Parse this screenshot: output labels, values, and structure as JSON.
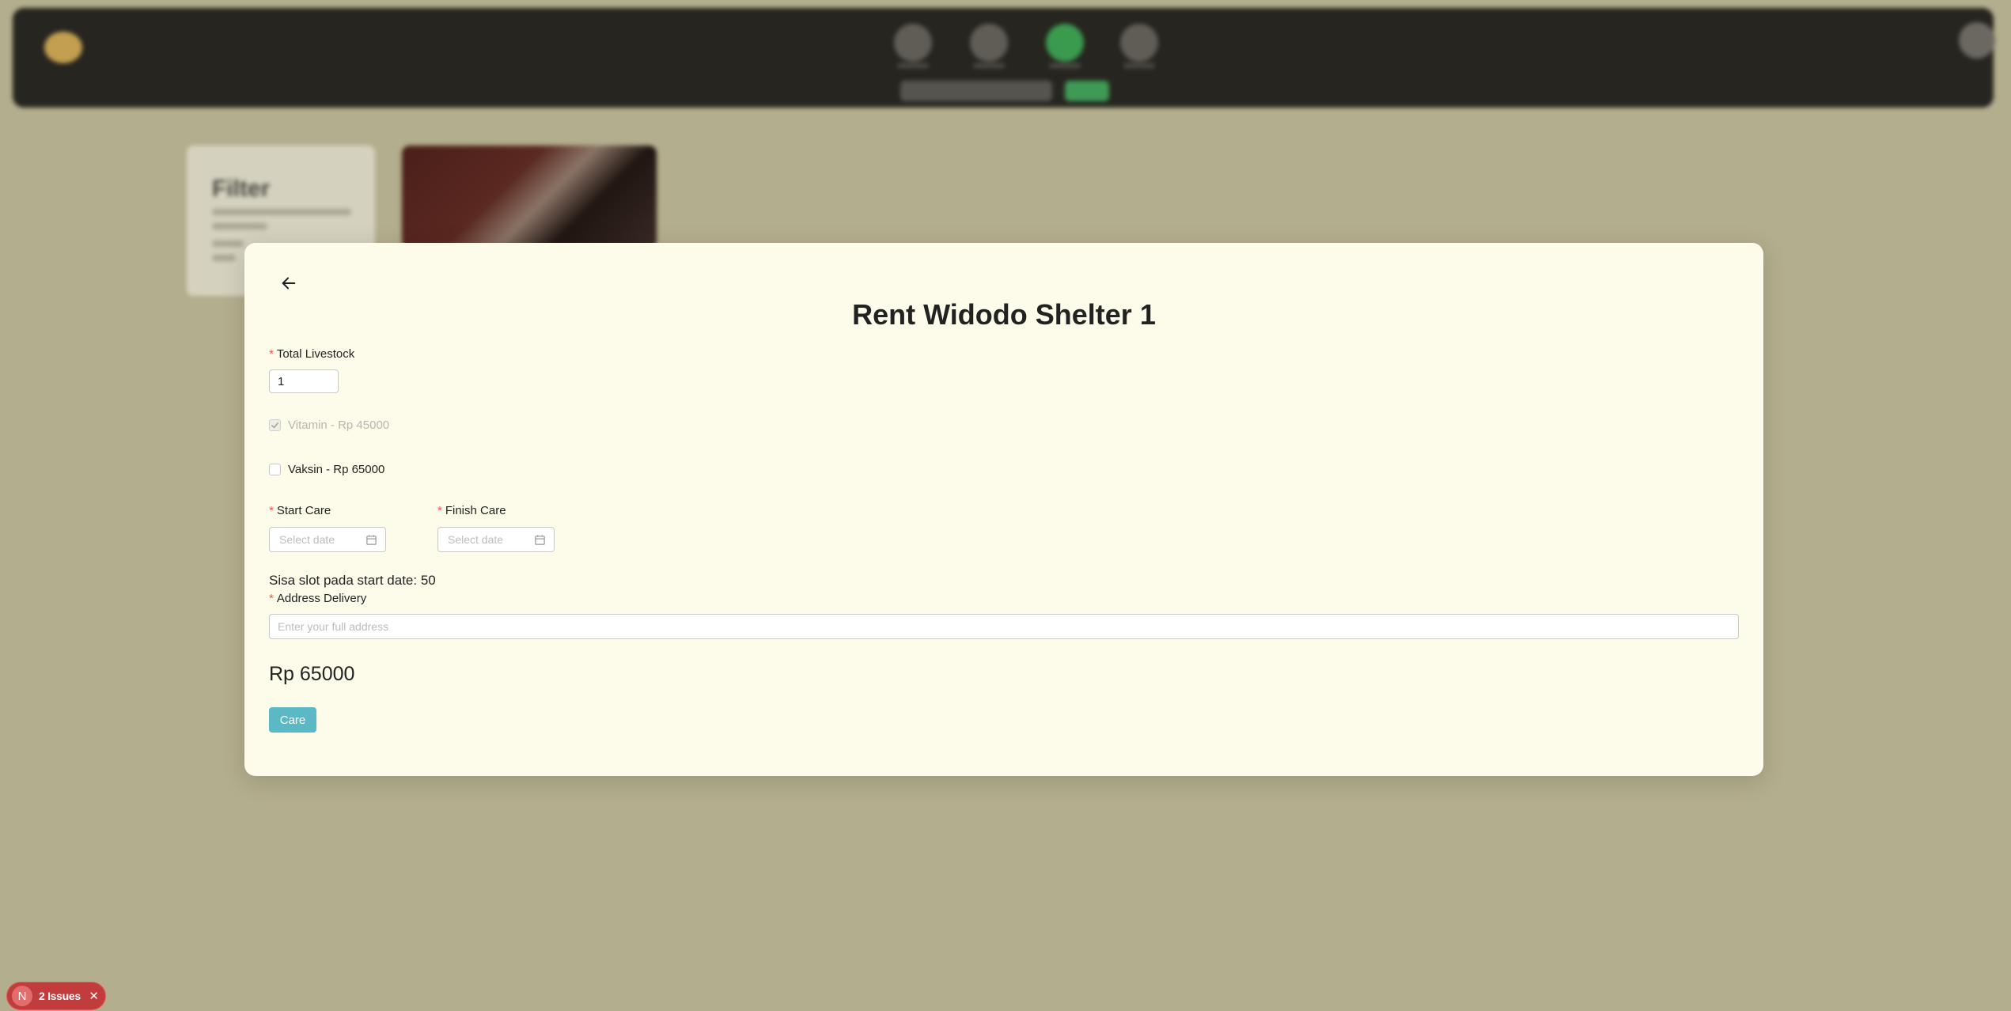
{
  "background": {
    "filter_card_title": "Filter"
  },
  "modal": {
    "title": "Rent Widodo Shelter 1",
    "total_livestock": {
      "label": "Total Livestock",
      "value": "1"
    },
    "addons": [
      {
        "label": "Vitamin - Rp 45000",
        "checked": true,
        "disabled": true
      },
      {
        "label": "Vaksin - Rp 65000",
        "checked": false,
        "disabled": false
      }
    ],
    "start_care": {
      "label": "Start Care",
      "placeholder": "Select date"
    },
    "finish_care": {
      "label": "Finish Care",
      "placeholder": "Select date"
    },
    "slot_info": "Sisa slot pada start date: 50",
    "address": {
      "label": "Address Delivery",
      "placeholder": "Enter your full address"
    },
    "price": "Rp 65000",
    "submit_label": "Care"
  },
  "issues_badge": {
    "letter": "N",
    "text": "2 Issues",
    "close": "✕"
  },
  "colors": {
    "accent": "#5ab9c4",
    "required": "#ff4d4f",
    "modal_bg": "#fdfcea",
    "overlay_bg": "#b3ae8d",
    "badge": "#c13c3c"
  }
}
